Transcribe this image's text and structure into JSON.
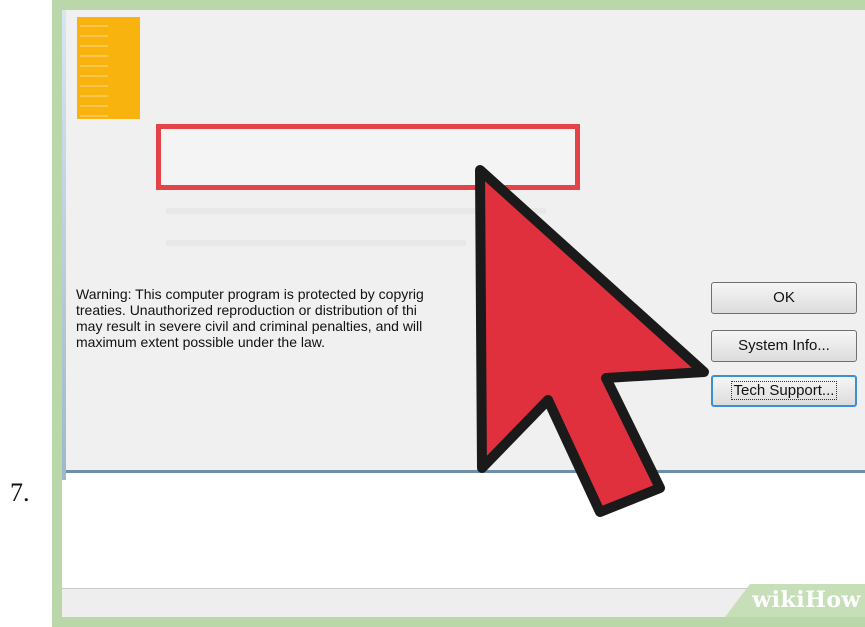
{
  "step": {
    "number": "7."
  },
  "dialog": {
    "warning_text": "Warning: This computer program is protected by copyrig         nal\ntreaties. Unauthorized reproduction or distribution of thi          n of it,\nmay result in severe civil and criminal penalties, and will\nmaximum extent possible under the law.",
    "buttons": {
      "ok": "OK",
      "system_info": "System Info...",
      "tech_support": "Tech Support..."
    }
  },
  "icons": {
    "logo": "app-logo-icon",
    "cursor": "arrow-cursor-icon"
  },
  "colors": {
    "frame": "#b9d7a8",
    "highlight": "#e4434a",
    "cursor_fill": "#e0303d",
    "logo": "#f9b30f"
  },
  "watermark": {
    "prefix": "wiki",
    "suffix": "How"
  }
}
